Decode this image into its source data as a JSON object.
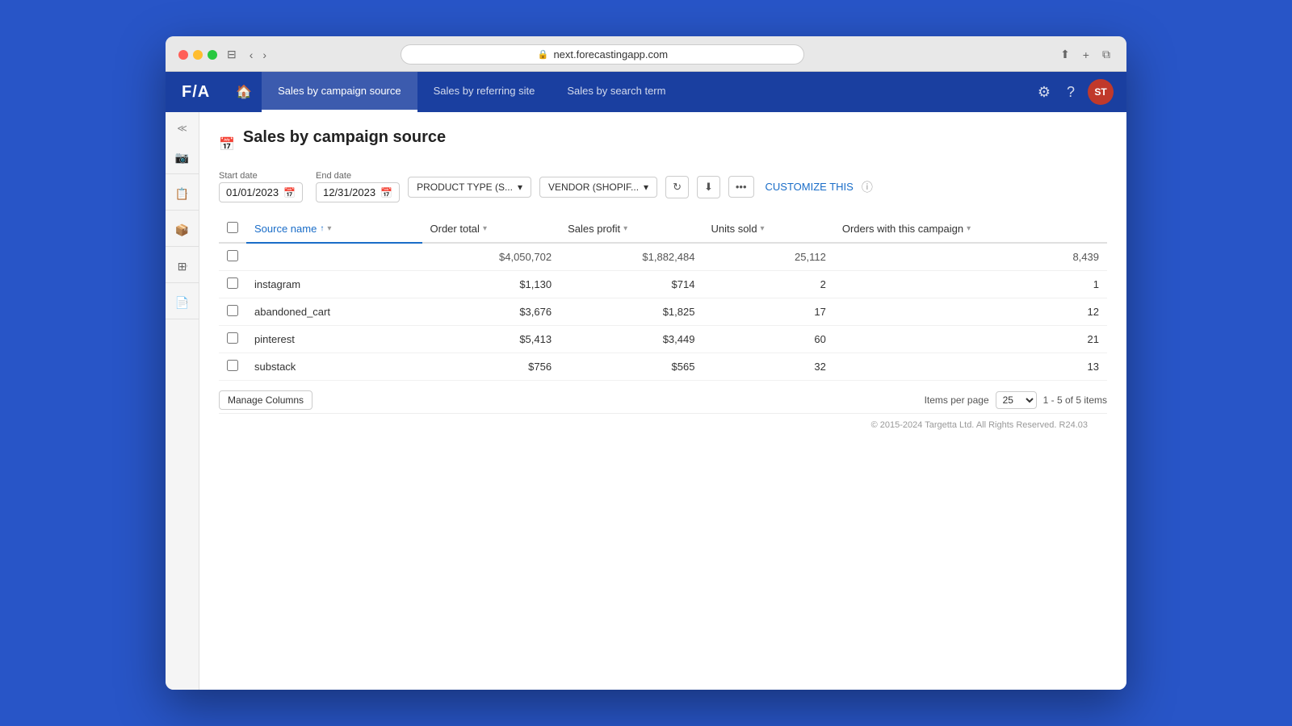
{
  "browser": {
    "url": "next.forecastingapp.com",
    "reload_label": "⟳"
  },
  "app": {
    "logo": "F/A",
    "nav_tabs": [
      {
        "label": "Sales by campaign source",
        "active": true
      },
      {
        "label": "Sales by referring site",
        "active": false
      },
      {
        "label": "Sales by search term",
        "active": false
      }
    ],
    "user_initials": "ST"
  },
  "sidebar": {
    "collapse_icon": "≪",
    "items": [
      {
        "icon": "📷",
        "has_expand": true
      },
      {
        "icon": "📋",
        "has_expand": true
      },
      {
        "icon": "📦",
        "has_expand": true
      },
      {
        "icon": "⊞",
        "has_expand": true
      },
      {
        "icon": "📄",
        "has_expand": true
      }
    ]
  },
  "page": {
    "title": "Sales by campaign source",
    "start_date_label": "Start date",
    "start_date": "01/01/2023",
    "end_date_label": "End date",
    "end_date": "12/31/2023",
    "filter_product": "PRODUCT TYPE (S...",
    "filter_vendor": "VENDOR (SHOPIF...",
    "customize_label": "CUSTOMIZE THIS",
    "footer_text": "© 2015-2024 Targetta Ltd. All Rights Reserved. R24.03"
  },
  "table": {
    "columns": [
      {
        "label": "Source name",
        "sorted": true,
        "sort_dir": "↑",
        "filter": true
      },
      {
        "label": "Order total",
        "sorted": false,
        "filter": true
      },
      {
        "label": "Sales profit",
        "sorted": false,
        "filter": true
      },
      {
        "label": "Units sold",
        "sorted": false,
        "filter": true
      },
      {
        "label": "Orders with this campaign",
        "sorted": false,
        "filter": true
      }
    ],
    "total_row": {
      "source": "",
      "order_total": "$4,050,702",
      "sales_profit": "$1,882,484",
      "units_sold": "25,112",
      "orders": "8,439"
    },
    "rows": [
      {
        "source": "instagram",
        "order_total": "$1,130",
        "sales_profit": "$714",
        "units_sold": "2",
        "orders": "1"
      },
      {
        "source": "abandoned_cart",
        "order_total": "$3,676",
        "sales_profit": "$1,825",
        "units_sold": "17",
        "orders": "12"
      },
      {
        "source": "pinterest",
        "order_total": "$5,413",
        "sales_profit": "$3,449",
        "units_sold": "60",
        "orders": "21"
      },
      {
        "source": "substack",
        "order_total": "$756",
        "sales_profit": "$565",
        "units_sold": "32",
        "orders": "13"
      }
    ],
    "manage_columns_label": "Manage Columns",
    "items_per_page_label": "Items per page",
    "items_per_page": "25",
    "pagination": "1 - 5 of 5 items"
  }
}
